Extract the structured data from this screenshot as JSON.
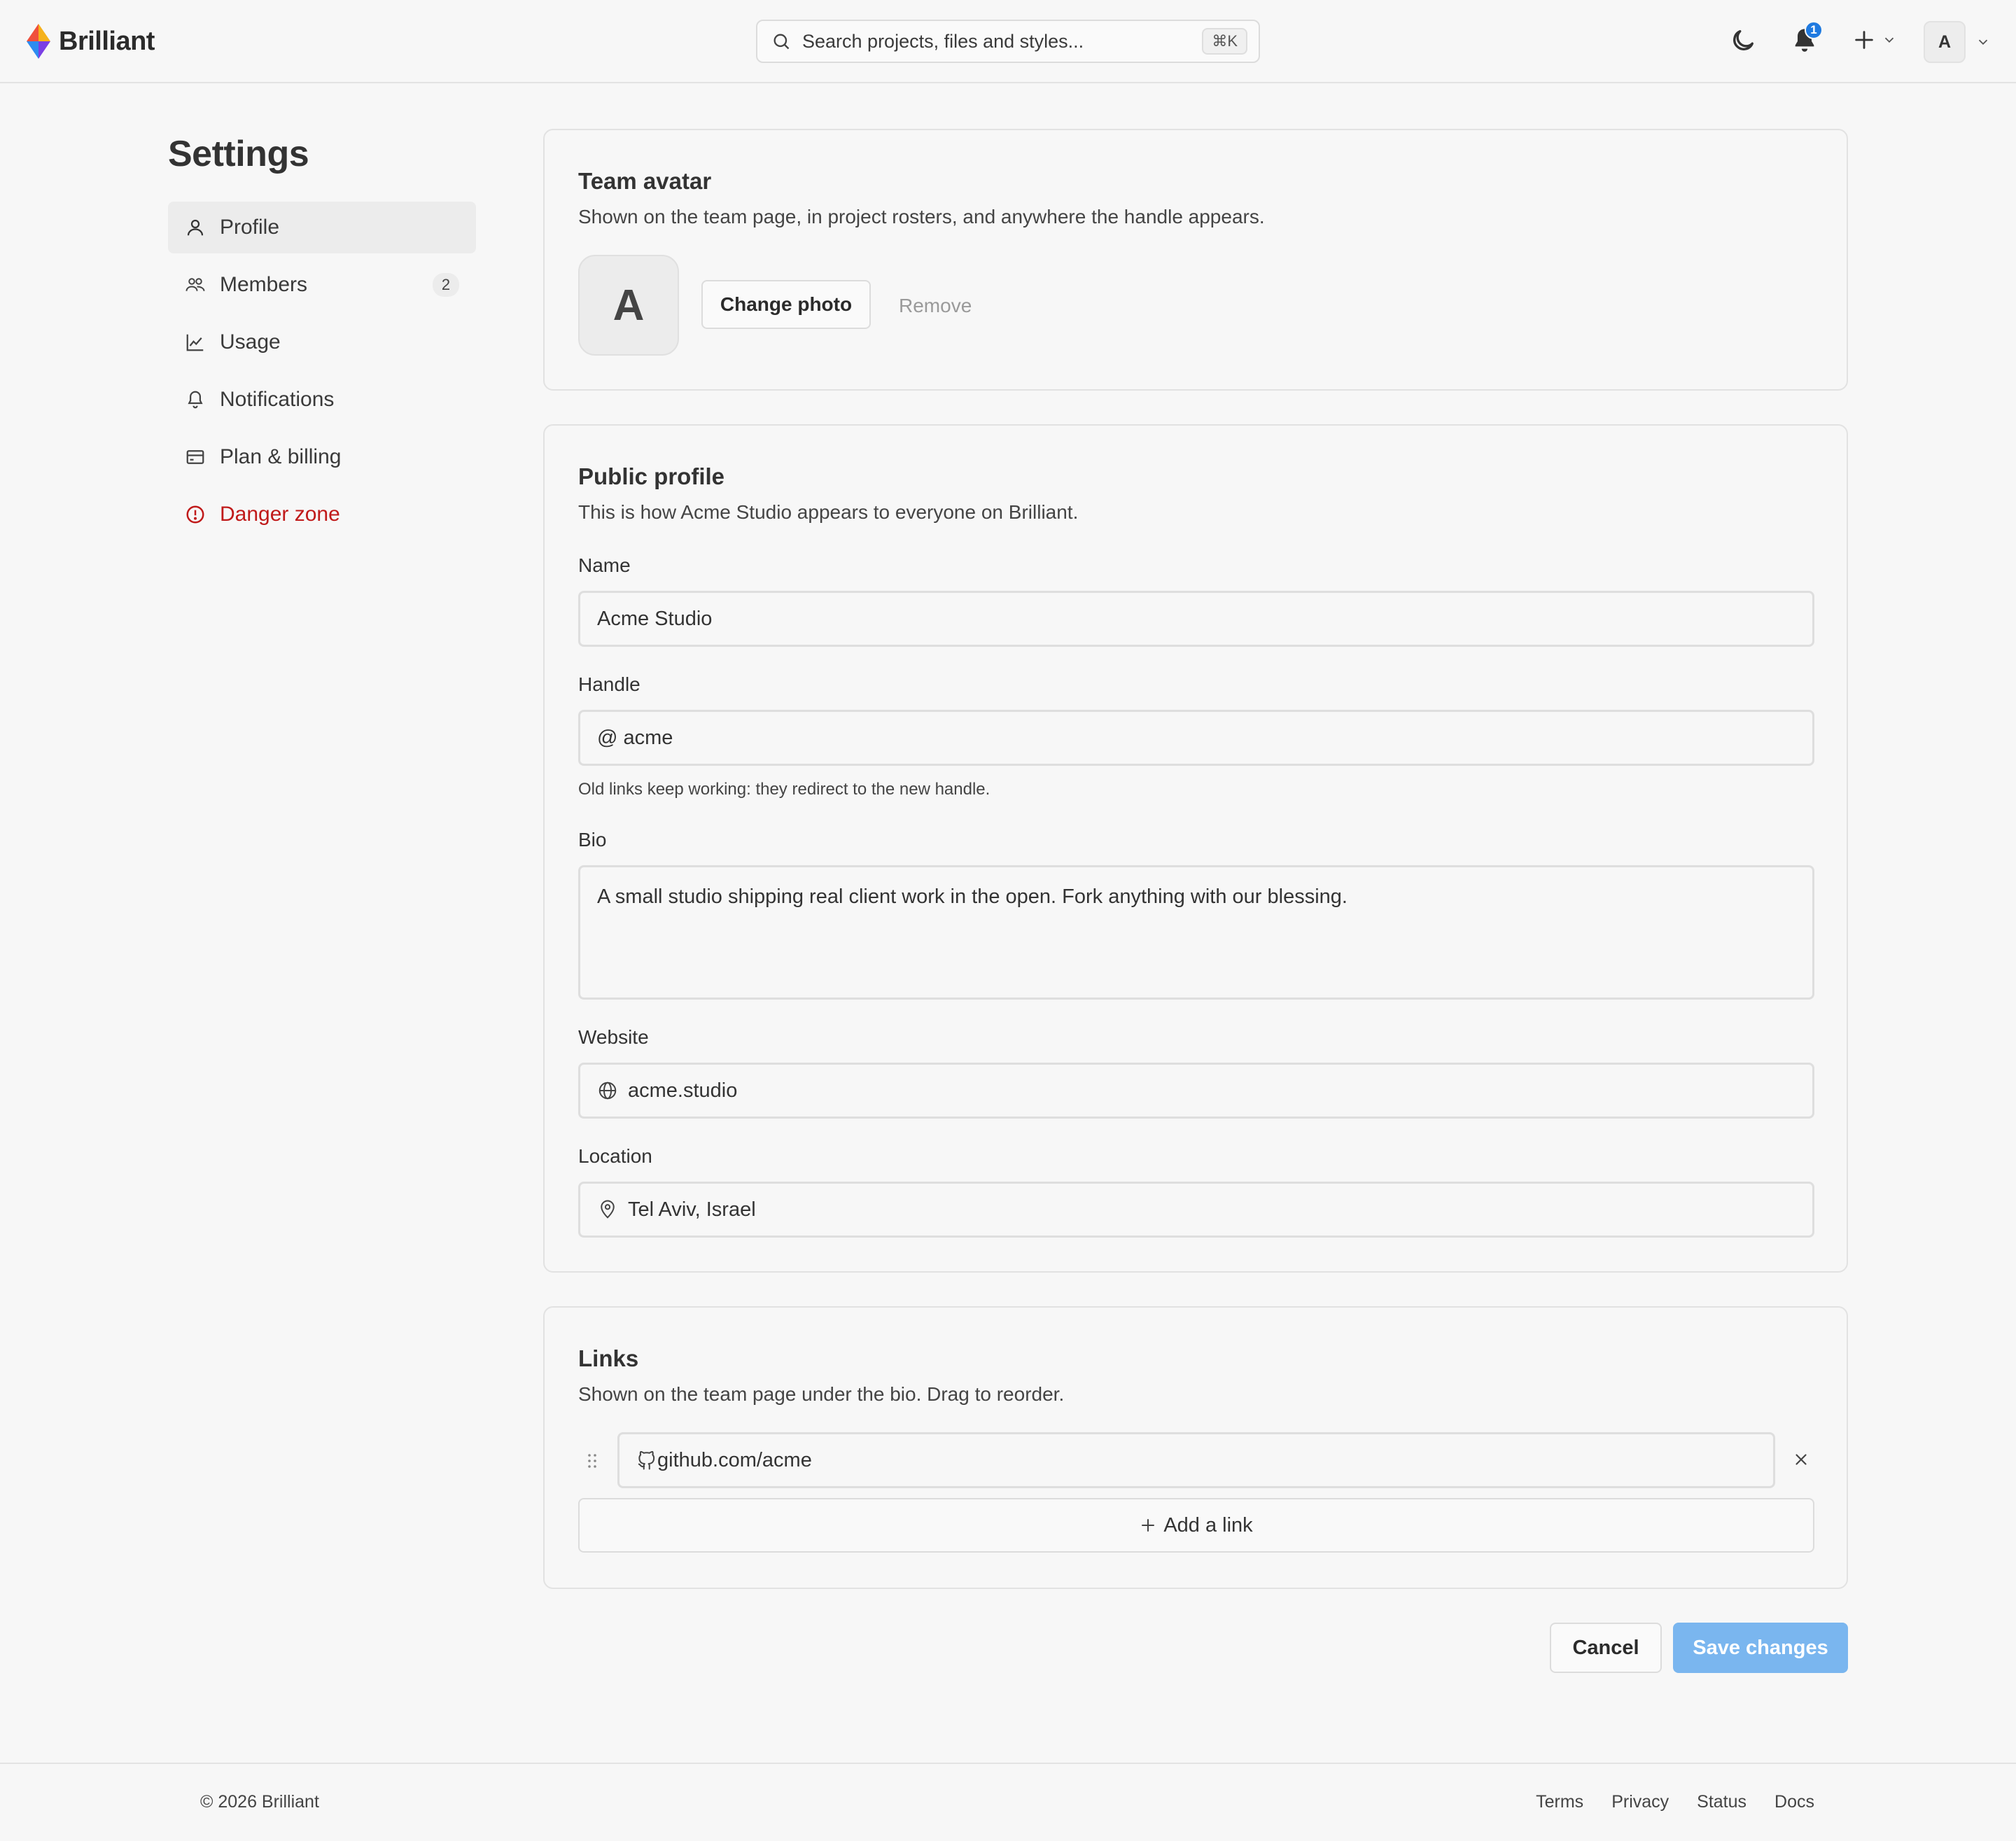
{
  "header": {
    "brand": "Brilliant",
    "search_placeholder": "Search projects, files and styles...",
    "search_shortcut": "⌘K",
    "notification_count": "1",
    "user_initial": "A"
  },
  "sidebar": {
    "title": "Settings",
    "items": [
      {
        "label": "Profile",
        "icon": "user-icon",
        "active": true
      },
      {
        "label": "Members",
        "icon": "users-icon",
        "count": "2"
      },
      {
        "label": "Usage",
        "icon": "chart-icon"
      },
      {
        "label": "Notifications",
        "icon": "bell-icon"
      },
      {
        "label": "Plan & billing",
        "icon": "credit-card-icon"
      },
      {
        "label": "Danger zone",
        "icon": "alert-circle-icon",
        "danger": true
      }
    ]
  },
  "avatar_card": {
    "title": "Team avatar",
    "subtitle": "Shown on the team page, in project rosters, and anywhere the handle appears.",
    "initial": "A",
    "change_label": "Change photo",
    "remove_label": "Remove"
  },
  "profile_card": {
    "title": "Public profile",
    "subtitle": "This is how Acme Studio appears to everyone on Brilliant.",
    "name_label": "Name",
    "name_value": "Acme Studio",
    "handle_label": "Handle",
    "handle_prefix": "@",
    "handle_value": "acme",
    "handle_hint": "Old links keep working: they redirect to the new handle.",
    "bio_label": "Bio",
    "bio_value": "A small studio shipping real client work in the open. Fork anything with our blessing.",
    "website_label": "Website",
    "website_value": "acme.studio",
    "location_label": "Location",
    "location_value": "Tel Aviv, Israel"
  },
  "links_card": {
    "title": "Links",
    "subtitle": "Shown on the team page under the bio. Drag to reorder.",
    "links": [
      {
        "value": "github.com/acme",
        "icon": "github-icon"
      }
    ],
    "add_label": "Add a link"
  },
  "actions": {
    "cancel_label": "Cancel",
    "save_label": "Save changes"
  },
  "footer": {
    "copyright": "© 2026 Brilliant",
    "links": [
      "Terms",
      "Privacy",
      "Status",
      "Docs"
    ]
  },
  "colors": {
    "accent": "#1f7ae0",
    "save_disabled": "#7ab6ef",
    "danger": "#c01a1a"
  }
}
